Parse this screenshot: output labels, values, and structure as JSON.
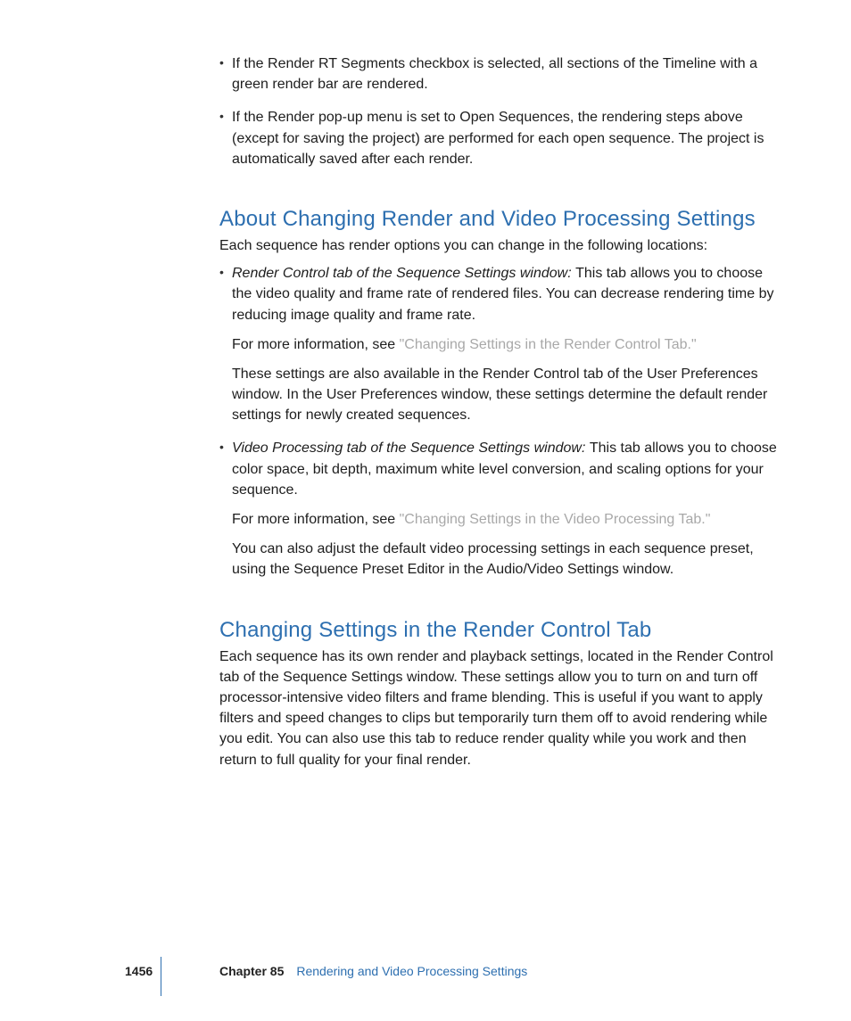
{
  "intro_bullets": [
    "If the Render RT Segments checkbox is selected, all sections of the Timeline with a green render bar are rendered.",
    "If the Render pop-up menu is set to Open Sequences, the rendering steps above (except for saving the project) are performed for each open sequence. The project is automatically saved after each render."
  ],
  "section1": {
    "heading": "About Changing Render and Video Processing Settings",
    "intro": "Each sequence has render options you can change in the following locations:",
    "items": [
      {
        "label": "Render Control tab of the Sequence Settings window:  ",
        "text": "This tab allows you to choose the video quality and frame rate of rendered files. You can decrease rendering time by reducing image quality and frame rate.",
        "more_prefix": "For more information, see ",
        "more_link": "\"Changing Settings in the Render Control Tab.\"",
        "after": "These settings are also available in the Render Control tab of the User Preferences window. In the User Preferences window, these settings determine the default render settings for newly created sequences."
      },
      {
        "label": "Video Processing tab of the Sequence Settings window:  ",
        "text": "This tab allows you to choose color space, bit depth, maximum white level conversion, and scaling options for your sequence.",
        "more_prefix": "For more information, see ",
        "more_link": "\"Changing Settings in the Video Processing Tab.\"",
        "after": "You can also adjust the default video processing settings in each sequence preset, using the Sequence Preset Editor in the Audio/Video Settings window."
      }
    ]
  },
  "section2": {
    "heading": "Changing Settings in the Render Control Tab",
    "body": "Each sequence has its own render and playback settings, located in the Render Control tab of the Sequence Settings window. These settings allow you to turn on and turn off processor-intensive video filters and frame blending. This is useful if you want to apply filters and speed changes to clips but temporarily turn them off to avoid rendering while you edit. You can also use this tab to reduce render quality while you work and then return to full quality for your final render."
  },
  "footer": {
    "page_number": "1456",
    "chapter_label": "Chapter 85",
    "chapter_title": "Rendering and Video Processing Settings"
  }
}
